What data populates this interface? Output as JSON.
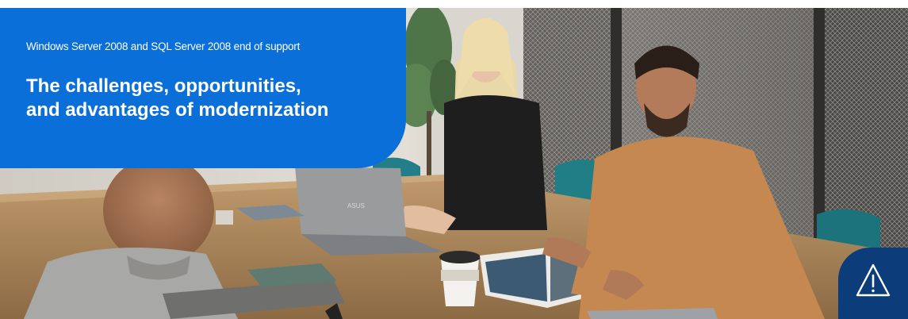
{
  "banner": {
    "eyebrow": "Windows Server 2008 and SQL Server 2008 end of support",
    "headline_line1": "The challenges, opportunities,",
    "headline_line2": "and advantages of modernization"
  },
  "photo": {
    "laptop_brand": "ASUS"
  },
  "colors": {
    "panel_blue": "#0a6fd8",
    "warning_tab_navy": "#0c3d7a"
  },
  "icons": {
    "warning": "warning-triangle-icon"
  }
}
